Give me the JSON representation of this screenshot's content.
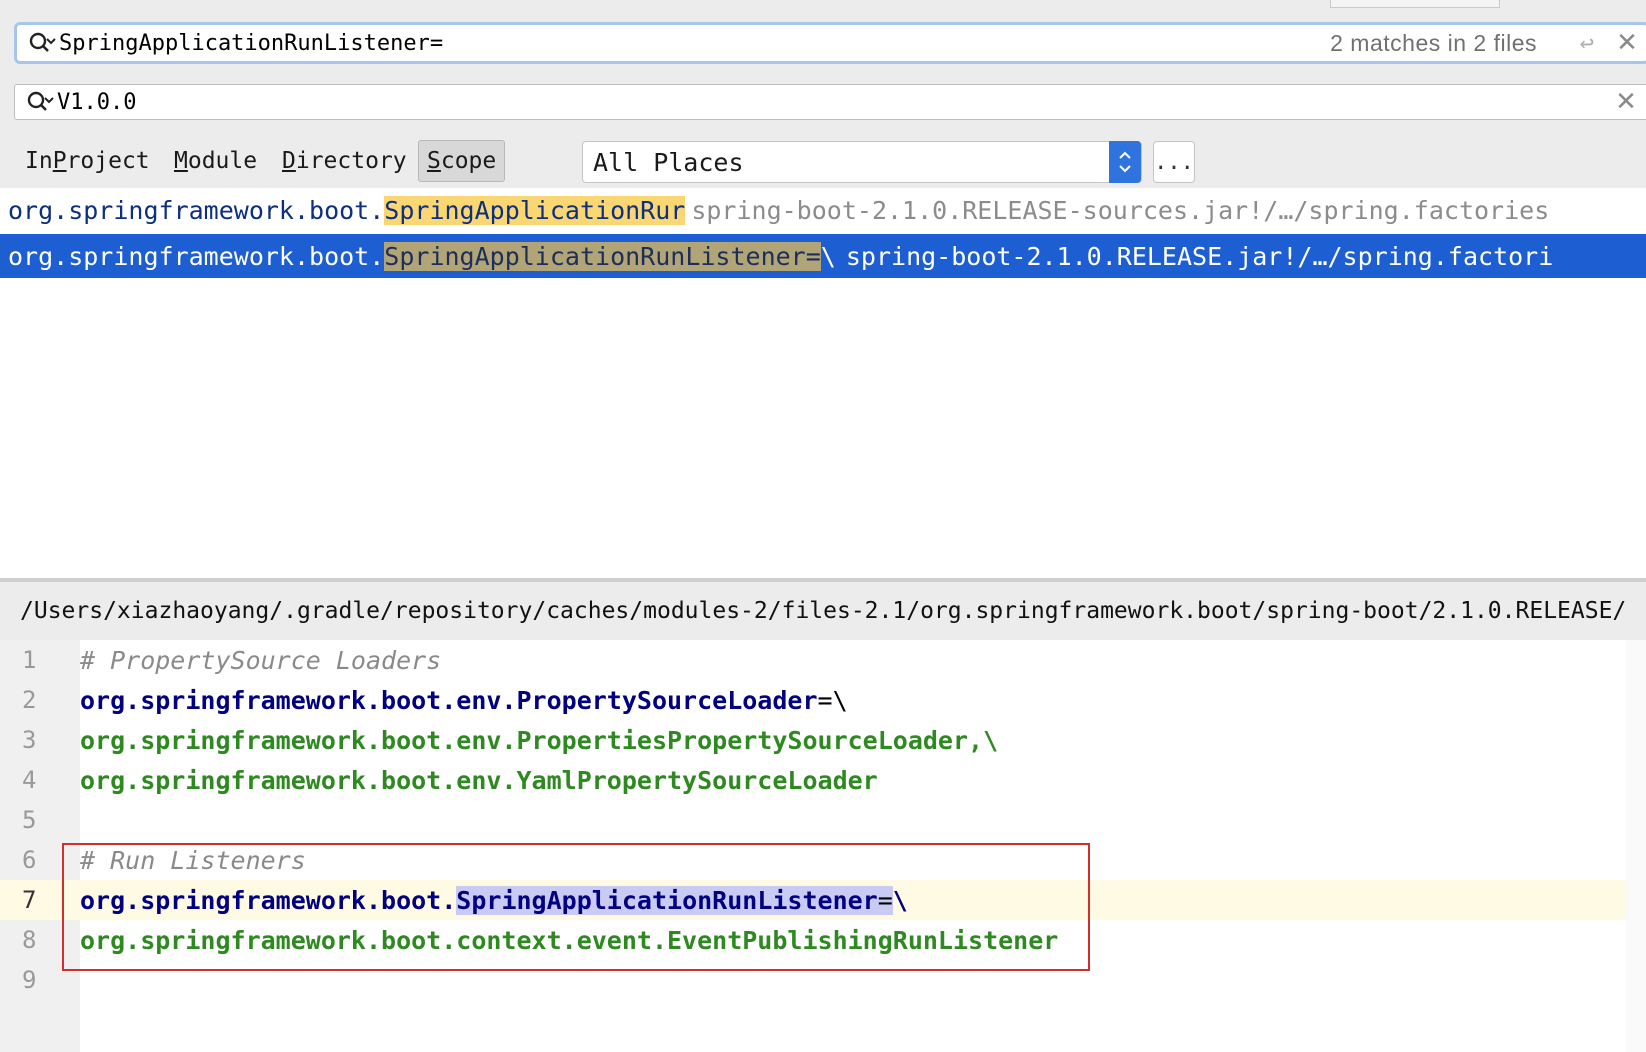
{
  "find_panel": {
    "search_query": "SpringApplicationRunListener=",
    "match_summary": "2 matches in 2 files",
    "file_mask": "V1.0.0"
  },
  "scope": {
    "tabs": [
      {
        "label_pre": "In ",
        "label_u": "P",
        "label_post": "roject"
      },
      {
        "label_pre": "",
        "label_u": "M",
        "label_post": "odule"
      },
      {
        "label_pre": "",
        "label_u": "D",
        "label_post": "irectory"
      },
      {
        "label_pre": "",
        "label_u": "S",
        "label_post": "cope"
      }
    ],
    "selected_tab": "Scope",
    "dropdown_value": "All Places",
    "more_button": "..."
  },
  "results": [
    {
      "prefix": "org.springframework.boot.",
      "match": "SpringApplicationRur",
      "tail": "",
      "location": "spring-boot-2.1.0.RELEASE-sources.jar!/…/spring.factories"
    },
    {
      "prefix": "org.springframework.boot.",
      "match": "SpringApplicationRunListener=",
      "tail": "\\",
      "location": "spring-boot-2.1.0.RELEASE.jar!/…/spring.factori"
    }
  ],
  "preview": {
    "file_path": "/Users/xiazhaoyang/.gradle/repository/caches/modules-2/files-2.1/org.springframework.boot/spring-boot/2.1.0.RELEASE/",
    "lines": [
      {
        "n": "1",
        "text": "# PropertySource Loaders"
      },
      {
        "n": "2",
        "text": "org.springframework.boot.env.PropertySourceLoader",
        "eq": "=\\"
      },
      {
        "n": "3",
        "text": "org.springframework.boot.env.PropertiesPropertySourceLoader,\\"
      },
      {
        "n": "4",
        "text": "org.springframework.boot.env.YamlPropertySourceLoader"
      },
      {
        "n": "5",
        "text": ""
      },
      {
        "n": "6",
        "text": "# Run Listeners"
      },
      {
        "n": "7",
        "pre": "org.springframework.boot.",
        "mark": "SpringApplicationRunListener",
        "eq": "=",
        "post": "\\"
      },
      {
        "n": "8",
        "text": "org.springframework.boot.context.event.EventPublishingRunListener"
      },
      {
        "n": "9",
        "text": ""
      }
    ],
    "current_line": "7"
  },
  "colors": {
    "selection": "#1d5fd2",
    "match_highlight": "#fbd774",
    "annotation_box": "#d42d2d",
    "property_key": "#000080",
    "property_value": "#2e8a20"
  }
}
